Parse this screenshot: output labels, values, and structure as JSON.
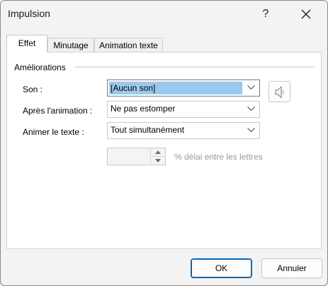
{
  "window": {
    "title": "Impulsion",
    "help_label": "?",
    "close_icon": "close-icon"
  },
  "tabs": [
    {
      "label": "Effet",
      "active": true
    },
    {
      "label": "Minutage",
      "active": false
    },
    {
      "label": "Animation texte",
      "active": false
    }
  ],
  "enhancements": {
    "group_label": "Améliorations",
    "sound": {
      "label": "Son :",
      "value": "[Aucun son]"
    },
    "after_animation": {
      "label": "Après l'animation :",
      "value": "Ne pas estomper"
    },
    "animate_text": {
      "label": "Animer le texte :",
      "value": "Tout simultanément"
    },
    "delay": {
      "value": "",
      "label": "% délai entre les lettres"
    },
    "speaker_icon": "speaker-icon"
  },
  "buttons": {
    "ok": "OK",
    "cancel": "Annuler"
  },
  "colors": {
    "selection": "#99c9ef",
    "accent": "#0067c0"
  }
}
